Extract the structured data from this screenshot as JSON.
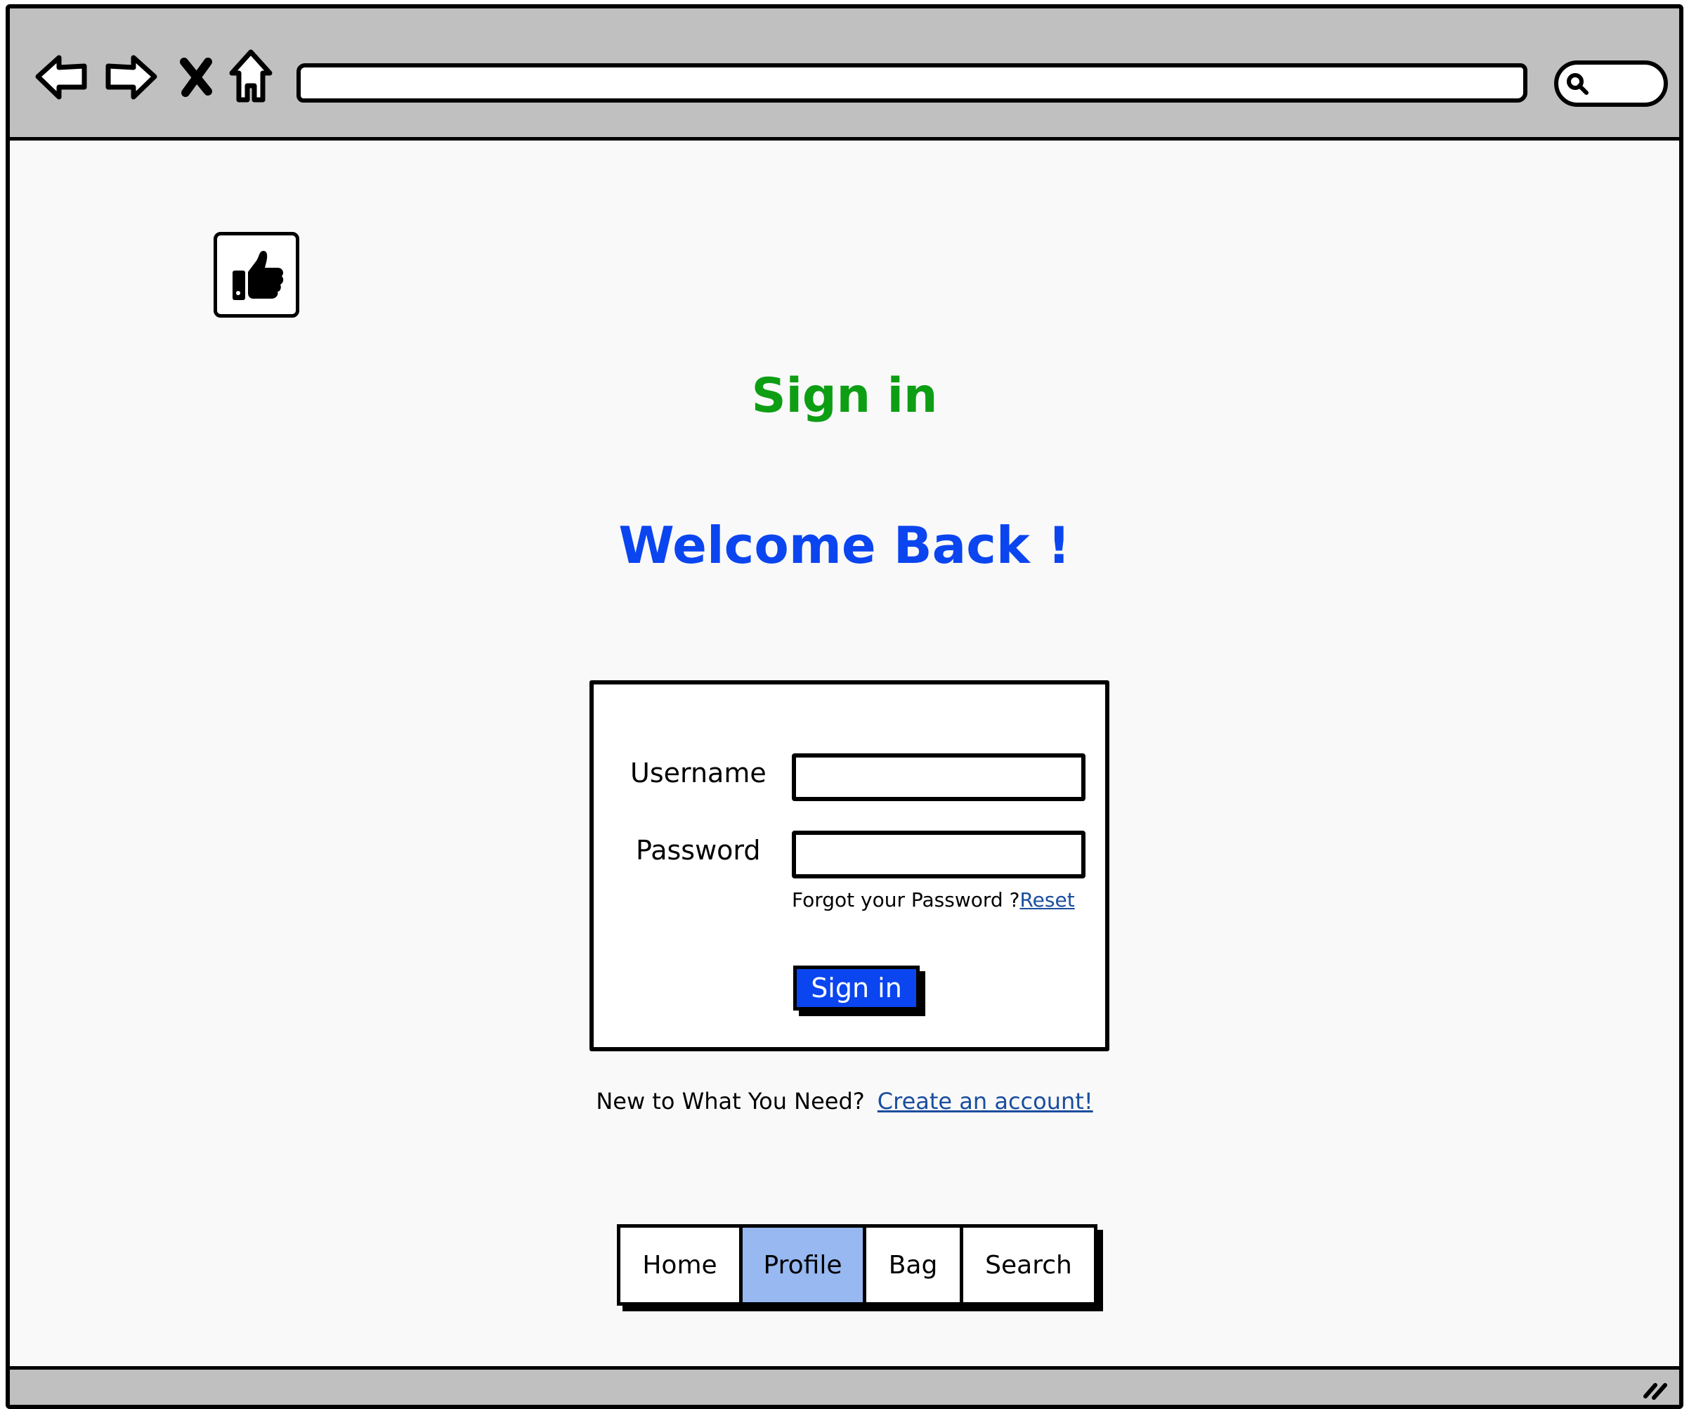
{
  "browser": {
    "nav_icons": [
      "back-arrow-icon",
      "forward-arrow-icon",
      "close-icon",
      "home-icon"
    ],
    "address_value": "",
    "search_icon": "search-icon"
  },
  "logo": {
    "icon": "thumbs-up-icon"
  },
  "page": {
    "title": "Sign in",
    "welcome": "Welcome Back !"
  },
  "form": {
    "username_label": "Username",
    "username_value": "",
    "password_label": "Password",
    "password_value": "",
    "forgot_text": "Forgot your Password ?",
    "reset_link": "Reset",
    "submit_label": "Sign in"
  },
  "signup": {
    "text": "New to What You Need?",
    "link": "Create an account!"
  },
  "tabs": [
    {
      "label": "Home",
      "active": false
    },
    {
      "label": "Profile",
      "active": true
    },
    {
      "label": "Bag",
      "active": false
    },
    {
      "label": "Search",
      "active": false
    }
  ],
  "colors": {
    "title": "#0d9e13",
    "welcome": "#0b45f0",
    "button": "#0b45f0",
    "active_tab": "#97b8f0",
    "link": "#1a4d9e",
    "chrome": "#c0c0c0"
  }
}
